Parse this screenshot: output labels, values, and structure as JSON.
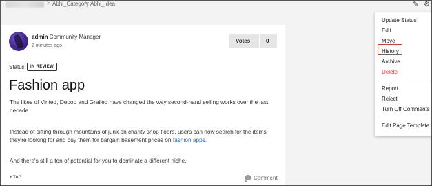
{
  "breadcrumb": {
    "items": [
      "Abhi_Category",
      "Abhi_Idea"
    ],
    "separator": ">"
  },
  "post": {
    "author": "admin",
    "role": "Community Manager",
    "time": "2 minutes ago",
    "votes_label": "Votes",
    "votes_count": "0",
    "status_label": "Status:",
    "status_value": "IN REVIEW",
    "title": "Fashion app",
    "paragraph1": "The likes of Vinted, Depop and Grailed have changed the way second-hand selling works over the last decade.",
    "paragraph2_pre": "Instead of sifting through mountains of junk on charity shop floors, users can now search for the items they're looking for and buy them for bargain basement prices on ",
    "paragraph2_link": "fashion apps",
    "paragraph2_post": ".",
    "paragraph3": "And there's still a ton of potential for you to dominate a different niche.",
    "tag_label": "+ TAG",
    "comment_label": "Comment"
  },
  "menu": {
    "items": [
      {
        "label": "Update Status"
      },
      {
        "label": "Edit"
      },
      {
        "label": "Move"
      },
      {
        "label": "History"
      },
      {
        "label": "Archive"
      },
      {
        "label": "Delete"
      },
      {
        "label": "Report"
      },
      {
        "label": "Reject"
      },
      {
        "label": "Turn Off Comments"
      },
      {
        "label": "Edit Page Template"
      }
    ]
  },
  "colors": {
    "link": "#2a6fb6",
    "danger": "#d6322a",
    "highlight": "#d63a32"
  },
  "icons": {
    "top_right": [
      "pin-icon",
      "gear-icon"
    ],
    "comment": "comment-bubble-icon"
  }
}
